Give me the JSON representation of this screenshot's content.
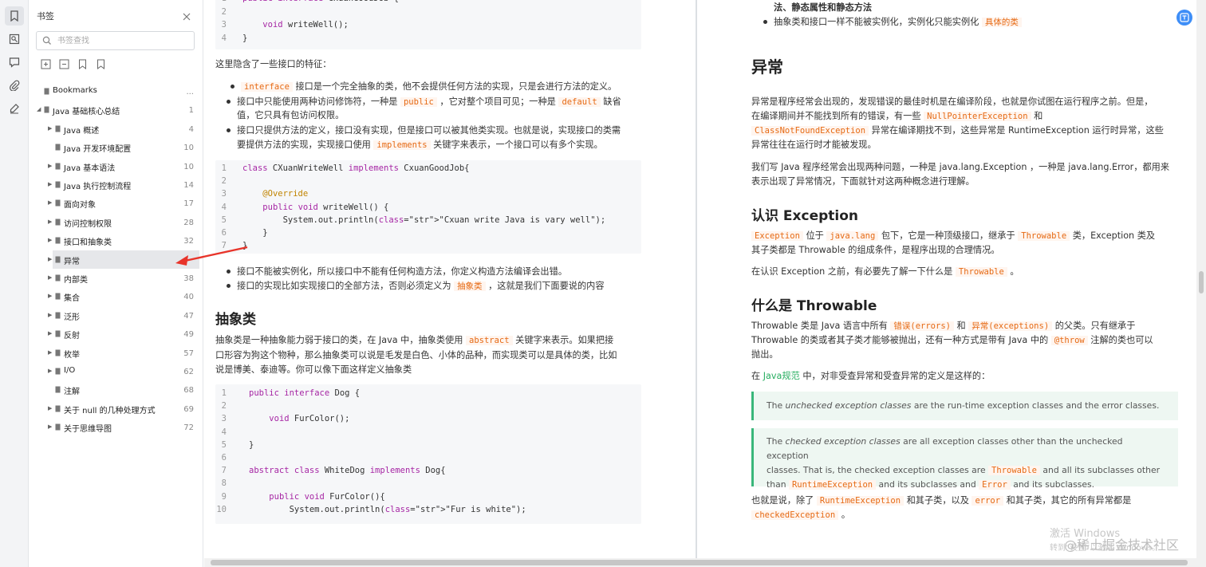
{
  "sidebar": {
    "title": "书签",
    "search_placeholder": "书签查找",
    "items": [
      {
        "label": "Bookmarks",
        "page": "...",
        "level": 0,
        "caret": false
      },
      {
        "label": "Java 基础核心总结",
        "page": "1",
        "level": 0,
        "caret": true,
        "expanded": true
      },
      {
        "label": "Java 概述",
        "page": "4",
        "level": 1,
        "caret": true
      },
      {
        "label": "Java 开发环境配置",
        "page": "10",
        "level": 1,
        "caret": false
      },
      {
        "label": "Java 基本语法",
        "page": "10",
        "level": 1,
        "caret": true
      },
      {
        "label": "Java 执行控制流程",
        "page": "14",
        "level": 1,
        "caret": true
      },
      {
        "label": "面向对象",
        "page": "17",
        "level": 1,
        "caret": true
      },
      {
        "label": "访问控制权限",
        "page": "28",
        "level": 1,
        "caret": true
      },
      {
        "label": "接口和抽象类",
        "page": "32",
        "level": 1,
        "caret": true
      },
      {
        "label": "异常",
        "page": "",
        "level": 1,
        "caret": true,
        "selected": true
      },
      {
        "label": "内部类",
        "page": "38",
        "level": 1,
        "caret": true
      },
      {
        "label": "集合",
        "page": "40",
        "level": 1,
        "caret": true
      },
      {
        "label": "泛形",
        "page": "47",
        "level": 1,
        "caret": true
      },
      {
        "label": "反射",
        "page": "49",
        "level": 1,
        "caret": true
      },
      {
        "label": "枚举",
        "page": "57",
        "level": 1,
        "caret": true
      },
      {
        "label": "I/O",
        "page": "62",
        "level": 1,
        "caret": true
      },
      {
        "label": "注解",
        "page": "68",
        "level": 1,
        "caret": false
      },
      {
        "label": "关于 null 的几种处理方式",
        "page": "69",
        "level": 1,
        "caret": true
      },
      {
        "label": "关于思维导图",
        "page": "72",
        "level": 1,
        "caret": true
      }
    ]
  },
  "left_doc": {
    "code1": [
      {
        "n": "1",
        "t": "public interface CxuanGoodJob {"
      },
      {
        "n": "2",
        "t": ""
      },
      {
        "n": "3",
        "t": "    void writeWell();"
      },
      {
        "n": "4",
        "t": "}"
      }
    ],
    "intro": "这里隐含了一些接口的特征：",
    "bullets1": [
      {
        "a": "",
        "code": "interface",
        "b": " 接口是一个完全抽象的类，他不会提供任何方法的实现，只是会进行方法的定义。"
      },
      {
        "a": "接口中只能使用两种访问修饰符，一种是 ",
        "code": "public",
        "b": " ，它对整个项目可见；一种是 ",
        "code2": "default",
        "c": " 缺省"
      },
      {
        "a": "值，它只具有包访问权限。"
      },
      {
        "a": "接口只提供方法的定义，接口没有实现，但是接口可以被其他类实现。也就是说，实现接口的类需"
      },
      {
        "a": "要提供方法的实现，实现接口使用 ",
        "code": "implements",
        "b": " 关键字来表示，一个接口可以有多个实现。"
      }
    ],
    "code2": [
      {
        "n": "1",
        "t": "class CXuanWriteWell implements CxuanGoodJob{"
      },
      {
        "n": "2",
        "t": ""
      },
      {
        "n": "3",
        "t": "    @Override"
      },
      {
        "n": "4",
        "t": "    public void writeWell() {"
      },
      {
        "n": "5",
        "t": "        System.out.println(\"Cxuan write Java is vary well\");"
      },
      {
        "n": "6",
        "t": "    }"
      },
      {
        "n": "7",
        "t": "}"
      }
    ],
    "bullets2": [
      {
        "a": "接口不能被实例化，所以接口中不能有任何构造方法，你定义构造方法编译会出错。"
      },
      {
        "a": "接口的实现比如实现接口的全部方法，否则必须定义为 ",
        "code": "抽象类",
        "b": " ，这就是我们下面要说的内容"
      }
    ],
    "heading_abstract": "抽象类",
    "abstract_para": [
      {
        "a": "抽象类是一种抽象能力弱于接口的类，在 Java 中，抽象类使用 ",
        "code": "abstract",
        "b": " 关键字来表示。如果把接"
      },
      {
        "a": "口形容为狗这个物种，那么抽象类可以说是毛发是白色、小体的品种，而实现类可以是具体的类，比如"
      },
      {
        "a": "说是博美、泰迪等。你可以像下面这样定义抽象类"
      }
    ],
    "code3": [
      {
        "n": "1",
        "t": "public interface Dog {"
      },
      {
        "n": "2",
        "t": ""
      },
      {
        "n": "3",
        "t": "    void FurColor();"
      },
      {
        "n": "4",
        "t": ""
      },
      {
        "n": "5",
        "t": "}"
      },
      {
        "n": "6",
        "t": ""
      },
      {
        "n": "7",
        "t": "abstract class WhiteDog implements Dog{"
      },
      {
        "n": "8",
        "t": ""
      },
      {
        "n": "9",
        "t": "    public void FurColor(){"
      },
      {
        "n": "10",
        "t": "        System.out.println(\"Fur is white\");"
      }
    ]
  },
  "right_doc": {
    "top_line": "法、静态属性和静态方法",
    "top_bullet_a": "抽象类和接口一样不能被实例化，实例化只能实例化 ",
    "top_bullet_code": "具体的类",
    "h_exception": "异常",
    "p1_a": "异常是程序经常会出现的，发现错误的最佳时机是在编译阶段，也就是你试图在运行程序之前。但是，",
    "p1_b": "在编译期间并不能找到所有的错误，有一些 ",
    "p1_code1": "NullPointerException",
    "p1_c": " 和",
    "p1_code2": "ClassNotFoundException",
    "p1_d": " 异常在编译期找不到，这些异常是 RuntimeException 运行时异常，这些",
    "p1_e": "异常往往在运行时才能被发现。",
    "p2_a": "我们写 Java 程序经常会出现两种问题，一种是 java.lang.Exception ，一种是 java.lang.Error，都用来",
    "p2_b": "表示出现了异常情况，下面就针对这两种概念进行理解。",
    "h_know": "认识 Exception",
    "p3_code1": "Exception",
    "p3_a": " 位于 ",
    "p3_code2": "java.lang",
    "p3_b": " 包下，它是一种顶级接口，继承于 ",
    "p3_code3": "Throwable",
    "p3_c": " 类，Exception 类及",
    "p3_d": "其子类都是 Throwable 的组成条件，是程序出现的合理情况。",
    "p4_a": "在认识 Exception 之前，有必要先了解一下什么是 ",
    "p4_code": "Throwable",
    "p4_b": " 。",
    "h_throwable": "什么是 Throwable",
    "p5_a": "Throwable 类是 Java 语言中所有 ",
    "p5_code1": "错误(errors)",
    "p5_b": " 和 ",
    "p5_code2": "异常(exceptions)",
    "p5_c": " 的父类。只有继承于",
    "p5_d": "Throwable 的类或者其子类才能够被抛出，还有一种方式是带有 Java 中的 ",
    "p5_code3": "@throw",
    "p5_e": " 注解的类也可以",
    "p5_f": "抛出。",
    "p6_a": "在 ",
    "p6_link": "Java规范",
    "p6_b": " 中，对非受查异常和受查异常的定义是这样的：",
    "q1_a": "The ",
    "q1_i": "unchecked exception classes",
    "q1_b": " are the run-time exception classes and the error classes.",
    "q2_a": "The ",
    "q2_i": "checked exception classes",
    "q2_b": " are all exception classes other than the unchecked exception",
    "q2_c": "classes. That is, the checked exception classes are ",
    "q2_code1": "Throwable",
    "q2_d": " and all its subclasses other",
    "q2_e": "than ",
    "q2_code2": "RuntimeException",
    "q2_f": " and its subclasses and ",
    "q2_code3": "Error",
    "q2_g": " and its subclasses.",
    "p7_a": "也就是说，除了 ",
    "p7_code1": "RuntimeException",
    "p7_b": " 和其子类，以及 ",
    "p7_code2": "error",
    "p7_c": " 和其子类，其它的所有异常都是",
    "p7_code3": "checkedException",
    "p7_d": " 。"
  },
  "watermark": {
    "activate": "激活 Windows",
    "activate_sub": "转到“设置”以激活 Windows。",
    "site": "@稀土掘金技术社区"
  },
  "colors": {
    "accent": "#3e8ef7",
    "arrow": "#e8342a",
    "inline_code": "#e66a14",
    "quote_border": "#39b67a"
  }
}
